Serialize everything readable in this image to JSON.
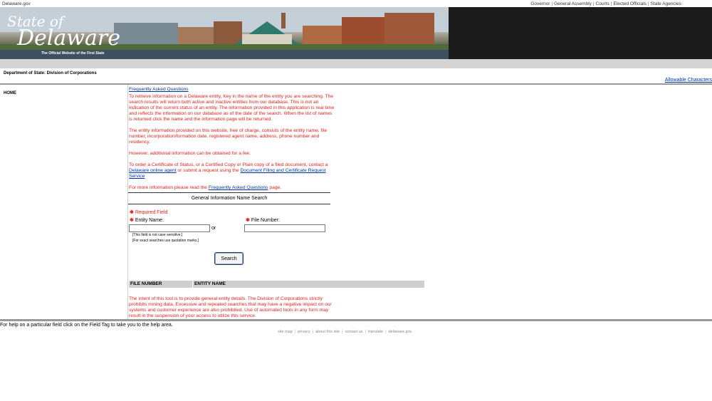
{
  "topbar": {
    "site": "Delaware.gov",
    "links": [
      "Governor",
      "General Assembly",
      "Courts",
      "Elected Officials",
      "State Agencies"
    ],
    "separator": "|"
  },
  "banner": {
    "logo_line1": "State of",
    "logo_line2": "Delaware",
    "tagline": "The Official Website of the First State"
  },
  "department": "Department of State: Division of Corporations",
  "allowable_link": "Allowable Characters",
  "sidenav": {
    "home": "HOME"
  },
  "content": {
    "faq_link": "Frequently Asked Questions",
    "para1": "To retrieve information on a Delaware entity, Key in the name of the entity you are searching. The search results will return both active and inactive entities from our database. This is not an indication of the current status of an entity. The information provided in this application is real time and reflects the information on our database as of the date of the search. When the list of names is returned click the name and the information page will be returned.",
    "para2": "The entity information provided on this website, free of charge, consists of the entity name, file number, incorporation/formation date, registered agent name, address, phone number and residency.",
    "para3": "However, additional information can be obtained for a fee.",
    "para4_a": "To order a Certificate of Status, or a Certified Copy or Plain copy of a filed document, contact a",
    "para4_link1": "Delaware online agent",
    "para4_b": "or submit a request using the",
    "para4_link2": "Document Filing and Certificate Request Service",
    "para5_a": "For more information please read the",
    "para5_link": "Frequently Asked Questions",
    "para5_b": "page."
  },
  "search_form": {
    "heading": "General Information Name Search",
    "required_marker": "✱",
    "required_label": "Required Field",
    "entity_label": "Entity Name:",
    "file_label": "File Number:",
    "or_text": "or",
    "entity_value": "",
    "file_value": "",
    "note1": "[This field is not case sensitive.]",
    "note2": "[For exact searches use quotation marks.]",
    "search_button": "Search"
  },
  "results_table": {
    "columns": [
      "FILE NUMBER",
      "ENTITY NAME"
    ]
  },
  "disclaimer": "The intent of this tool is to provide general entity details. The Division of Corporations strictly prohibits mining data. Excessive and repeated searches that may have a negative impact on our systems and customer experience are also prohibited. Use of automated tools in any form may result in the suspension of your access to utilize this service.",
  "help_text": "For help on a particular field click on the Field Tag to take you to the help area.",
  "footer": {
    "links": [
      "site map",
      "privacy",
      "about this site",
      "contact us",
      "translate",
      "delaware.gov"
    ],
    "separator": "|"
  },
  "colors": {
    "accent_red": "#e8211a",
    "link_blue": "#0033aa",
    "grey_bar": "#d4d4d4"
  }
}
